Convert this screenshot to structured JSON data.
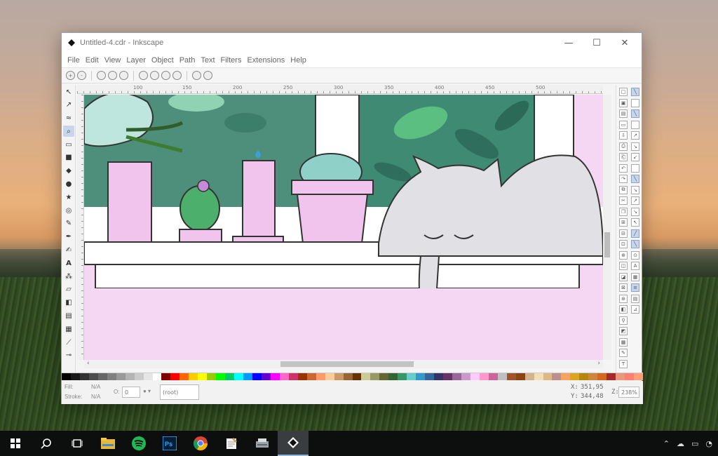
{
  "window": {
    "title": "Untitled-4.cdr - Inkscape",
    "controls": {
      "minimize": "—",
      "maximize": "☐",
      "close": "✕"
    }
  },
  "menu": [
    "File",
    "Edit",
    "View",
    "Layer",
    "Object",
    "Path",
    "Text",
    "Filters",
    "Extensions",
    "Help"
  ],
  "ruler_labels": [
    "100",
    "150",
    "200",
    "250",
    "300",
    "350",
    "400",
    "450",
    "500",
    "550",
    "600",
    "650"
  ],
  "status": {
    "fill_label": "Fill:",
    "fill_value": "N/A",
    "stroke_label": "Stroke:",
    "stroke_value": "N/A",
    "opacity_label": "O:",
    "opacity_value": "0",
    "layer_value": "(root)",
    "x_label": "X:",
    "x_value": "351,95",
    "y_label": "Y:",
    "y_value": "344,48",
    "zoom_label": "Z:",
    "zoom_value": "238%"
  },
  "palette": [
    "#000000",
    "#1a1a1a",
    "#333333",
    "#4d4d4d",
    "#666666",
    "#808080",
    "#999999",
    "#b3b3b3",
    "#cccccc",
    "#e6e6e6",
    "#ffffff",
    "#800000",
    "#ff0000",
    "#ff6600",
    "#ffcc00",
    "#ffff00",
    "#99cc00",
    "#00ff00",
    "#00cc66",
    "#00ffff",
    "#0099ff",
    "#0000ff",
    "#6600cc",
    "#ff00ff",
    "#ff66cc",
    "#cc3366",
    "#993300",
    "#cc6633",
    "#ff9966",
    "#ffcc99",
    "#cc9966",
    "#996633",
    "#663300",
    "#cccc99",
    "#999966",
    "#666633",
    "#336633",
    "#339966",
    "#66cccc",
    "#3399cc",
    "#336699",
    "#333366",
    "#663366",
    "#996699",
    "#cc99cc",
    "#ffccff",
    "#ff99cc",
    "#cc6699",
    "#c0c0c0",
    "#a0522d",
    "#8b4513",
    "#d2b48c",
    "#f5deb3",
    "#deb887",
    "#bc8f8f",
    "#f4a460",
    "#daa520",
    "#b8860b",
    "#cd853f",
    "#d2691e",
    "#a52a2a",
    "#e9967a",
    "#fa8072",
    "#ffa07a"
  ],
  "colors": {
    "canvas_bg": "#f6d7f3",
    "window_green": "#4d8f7a",
    "pot_pink": "#f1c4ee",
    "cat_gray": "#e0e0e4",
    "taskbar": "#0d0f0e",
    "accent": "#8fb8de"
  },
  "left_tools": [
    "selector-icon",
    "node-icon",
    "tweak-icon",
    "zoom-icon",
    "measure-icon",
    "rect-icon",
    "3dbox-icon",
    "ellipse-icon",
    "star-icon",
    "spiral-icon",
    "pencil-icon",
    "pen-icon",
    "calligraphy-icon",
    "text-icon",
    "spray-icon",
    "eraser-icon",
    "bucket-icon",
    "gradient-icon",
    "mesh-icon",
    "dropper-icon",
    "connector-icon"
  ],
  "taskbar": [
    "windows-start-icon",
    "search-icon",
    "task-view-icon",
    "file-explorer-icon",
    "spotify-icon",
    "photoshop-icon",
    "chrome-icon",
    "notepad-icon",
    "scanner-icon",
    "inkscape-icon"
  ]
}
